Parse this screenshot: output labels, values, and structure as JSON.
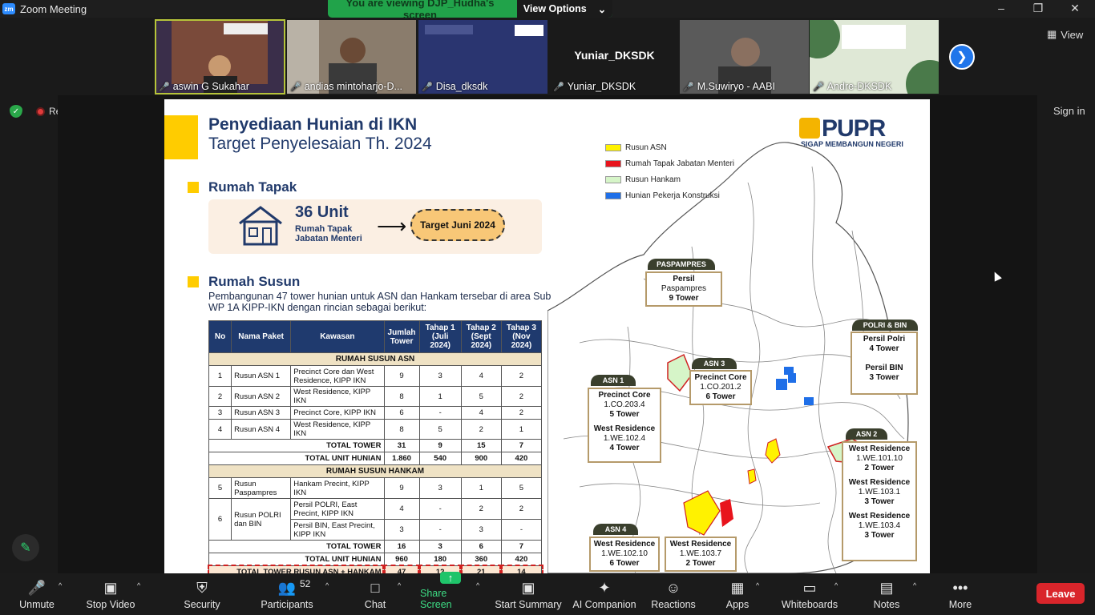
{
  "window": {
    "app_title": "Zoom Meeting"
  },
  "banner": {
    "viewing_text": "You are viewing DJP_Hudha's screen",
    "view_options": "View Options"
  },
  "gallery": {
    "participants": [
      {
        "name": "aswin G Sukahar",
        "muted": false
      },
      {
        "name": "andias mintoharjo-D...",
        "muted": true
      },
      {
        "name": "Disa_dksdk",
        "muted": true
      },
      {
        "name": "Yuniar_DKSDK",
        "muted": true,
        "center_label": "Yuniar_DKSDK"
      },
      {
        "name": "M.Suwiryo - AABI",
        "muted": true
      },
      {
        "name": "Andre-DKSDK",
        "muted": true
      }
    ],
    "view_label": "View"
  },
  "status": {
    "recording_label": "Recording",
    "sign_in": "Sign in"
  },
  "slide": {
    "title1": "Penyediaan Hunian di IKN",
    "title2": "Target Penyelesaian Th. 2024",
    "logo_word": "PUPR",
    "logo_tagline": "SIGAP MEMBANGUN NEGERI",
    "tapak": {
      "heading": "Rumah Tapak",
      "units": "36 Unit",
      "label1": "Rumah Tapak",
      "label2": "Jabatan Menteri",
      "target": "Target Juni 2024"
    },
    "susun": {
      "heading": "Rumah Susun",
      "desc": "Pembangunan 47 tower hunian untuk ASN dan Hankam tersebar di area Sub WP 1A KIPP-IKN dengan rincian sebagai berikut:"
    },
    "table": {
      "headers": [
        "No",
        "Nama Paket",
        "Kawasan",
        "Jumlah Tower",
        "Tahap 1 (Juli 2024)",
        "Tahap 2 (Sept 2024)",
        "Tahap 3 (Nov 2024)"
      ],
      "group_asn": "RUMAH SUSUN ASN",
      "asn_rows": [
        [
          "1",
          "Rusun ASN 1",
          "Precinct Core dan West Residence, KIPP IKN",
          "9",
          "3",
          "4",
          "2"
        ],
        [
          "2",
          "Rusun ASN 2",
          "West Residence, KIPP IKN",
          "8",
          "1",
          "5",
          "2"
        ],
        [
          "3",
          "Rusun ASN 3",
          "Precinct Core, KIPP IKN",
          "6",
          "-",
          "4",
          "2"
        ],
        [
          "4",
          "Rusun ASN 4",
          "West Residence, KIPP IKN",
          "8",
          "5",
          "2",
          "1"
        ]
      ],
      "asn_total_tower": [
        "TOTAL TOWER",
        "31",
        "9",
        "15",
        "7"
      ],
      "asn_total_unit": [
        "TOTAL  UNIT HUNIAN",
        "1.860",
        "540",
        "900",
        "420"
      ],
      "group_hankam": "RUMAH SUSUN HANKAM",
      "hk_row5": [
        "5",
        "Rusun Paspampres",
        "Hankam Precint, KIPP IKN",
        "9",
        "3",
        "1",
        "5"
      ],
      "hk_row6": {
        "no": "6",
        "name": "Rusun POLRI dan BIN",
        "a": [
          "Persil POLRI, East Precint, KIPP IKN",
          "4",
          "-",
          "2",
          "2"
        ],
        "b": [
          "Persil BIN, East Precint, KIPP IKN",
          "3",
          "-",
          "3",
          "-"
        ]
      },
      "hk_total_tower": [
        "TOTAL TOWER",
        "16",
        "3",
        "6",
        "7"
      ],
      "hk_total_unit": [
        "TOTAL UNIT HUNIAN",
        "960",
        "180",
        "360",
        "420"
      ],
      "grand_total": [
        "TOTAL TOWER RUSUN ASN + HANKAM",
        "47",
        "12",
        "21",
        "14"
      ]
    },
    "legend": [
      {
        "label": "Rusun ASN",
        "color": "#fff200"
      },
      {
        "label": "Rumah Tapak Jabatan Menteri",
        "color": "#e8141c"
      },
      {
        "label": "Rusun Hankam",
        "color": "#d6f5c8"
      },
      {
        "label": "Hunian Pekerja Konstruksi",
        "color": "#1f6fe8"
      }
    ],
    "map_labels": {
      "paspampres_tag": "PASPAMPRES",
      "paspampres_a": "Persil",
      "paspampres_b": "Paspampres",
      "paspampres_c": "9 Tower",
      "polri_tag": "POLRI & BIN",
      "polri_a": "Persil Polri",
      "polri_b": "4 Tower",
      "bin_a": "Persil BIN",
      "bin_b": "3 Tower",
      "asn1_tag": "ASN 1",
      "asn1_a1": "Precinct Core",
      "asn1_a2": "1.CO.203.4",
      "asn1_a3": "5 Tower",
      "asn1_b1": "West Residence",
      "asn1_b2": "1.WE.102.4",
      "asn1_b3": "4 Tower",
      "asn3_tag": "ASN 3",
      "asn3_a": "Precinct Core",
      "asn3_b": "1.CO.201.2",
      "asn3_c": "6 Tower",
      "asn2_tag": "ASN 2",
      "asn2_a1": "West Residence",
      "asn2_a2": "1.WE.101.10",
      "asn2_a3": "2 Tower",
      "asn2_b1": "West Residence",
      "asn2_b2": "1.WE.103.1",
      "asn2_b3": "3 Tower",
      "asn2_c1": "West Residence",
      "asn2_c2": "1.WE.103.4",
      "asn2_c3": "3 Tower",
      "asn4_tag": "ASN 4",
      "asn4_a1": "West Residence",
      "asn4_a2": "1.WE.102.10",
      "asn4_a3": "6 Tower",
      "asn4_b1": "West Residence",
      "asn4_b2": "1.WE.103.7",
      "asn4_b3": "2 Tower"
    }
  },
  "toolbar": {
    "unmute": "Unmute",
    "stop_video": "Stop Video",
    "security": "Security",
    "participants": "Participants",
    "participant_count": "52",
    "chat": "Chat",
    "share_screen": "Share Screen",
    "start_summary": "Start Summary",
    "ai_companion": "AI Companion",
    "reactions": "Reactions",
    "apps": "Apps",
    "whiteboards": "Whiteboards",
    "notes": "Notes",
    "more": "More",
    "leave": "Leave"
  }
}
